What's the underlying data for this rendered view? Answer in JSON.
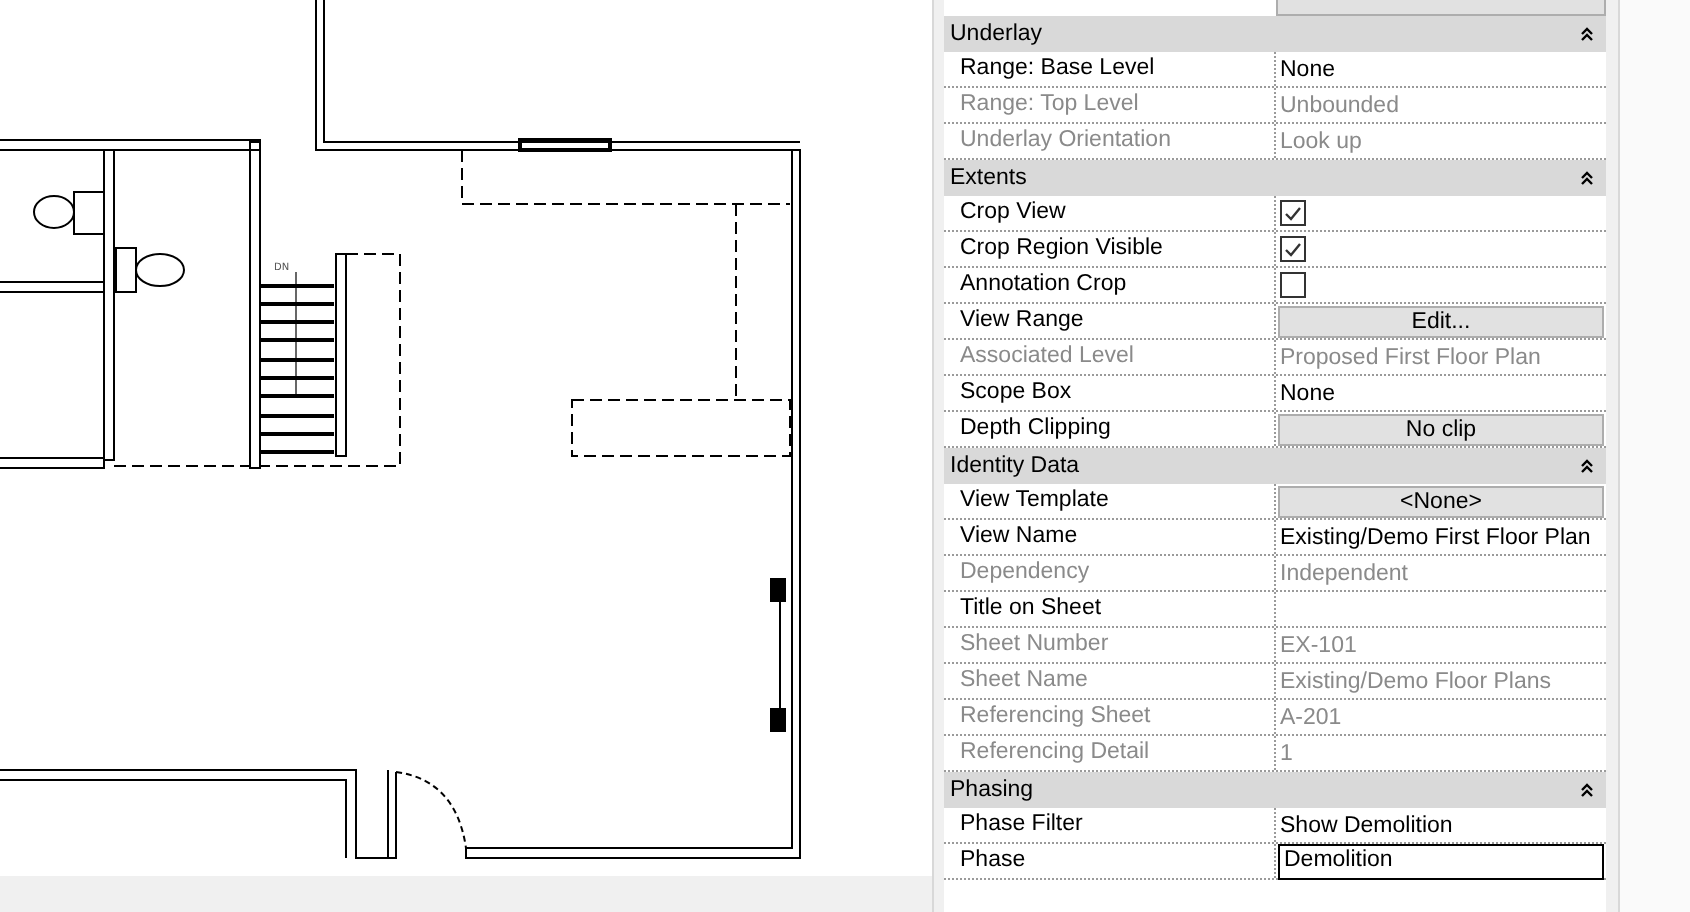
{
  "floor_plan": {
    "stair_label": "DN"
  },
  "properties": {
    "sections": [
      {
        "title": "Underlay",
        "expanded": true,
        "rows": [
          {
            "label": "Range: Base Level",
            "kind": "text",
            "value": "None",
            "disabled": false
          },
          {
            "label": "Range: Top Level",
            "kind": "text",
            "value": "Unbounded",
            "disabled": true
          },
          {
            "label": "Underlay Orientation",
            "kind": "text",
            "value": "Look up",
            "disabled": true
          }
        ]
      },
      {
        "title": "Extents",
        "expanded": true,
        "rows": [
          {
            "label": "Crop View",
            "kind": "checkbox",
            "checked": true,
            "disabled": false
          },
          {
            "label": "Crop Region Visible",
            "kind": "checkbox",
            "checked": true,
            "disabled": false
          },
          {
            "label": "Annotation Crop",
            "kind": "checkbox",
            "checked": false,
            "disabled": false
          },
          {
            "label": "View Range",
            "kind": "button",
            "value": "Edit...",
            "disabled": false
          },
          {
            "label": "Associated Level",
            "kind": "text",
            "value": "Proposed First Floor Plan",
            "disabled": true
          },
          {
            "label": "Scope Box",
            "kind": "text",
            "value": "None",
            "disabled": false
          },
          {
            "label": "Depth Clipping",
            "kind": "button",
            "value": "No clip",
            "disabled": false
          }
        ]
      },
      {
        "title": "Identity Data",
        "expanded": true,
        "rows": [
          {
            "label": "View Template",
            "kind": "button",
            "value": "<None>",
            "disabled": false
          },
          {
            "label": "View Name",
            "kind": "text",
            "value": "Existing/Demo First Floor Plan",
            "disabled": false
          },
          {
            "label": "Dependency",
            "kind": "text",
            "value": "Independent",
            "disabled": true
          },
          {
            "label": "Title on Sheet",
            "kind": "text",
            "value": "",
            "disabled": false
          },
          {
            "label": "Sheet Number",
            "kind": "text",
            "value": "EX-101",
            "disabled": true
          },
          {
            "label": "Sheet Name",
            "kind": "text",
            "value": "Existing/Demo Floor Plans",
            "disabled": true
          },
          {
            "label": "Referencing Sheet",
            "kind": "text",
            "value": "A-201",
            "disabled": true
          },
          {
            "label": "Referencing Detail",
            "kind": "text",
            "value": "1",
            "disabled": true
          }
        ]
      },
      {
        "title": "Phasing",
        "expanded": true,
        "rows": [
          {
            "label": "Phase Filter",
            "kind": "text",
            "value": "Show Demolition",
            "disabled": false
          },
          {
            "label": "Phase",
            "kind": "field",
            "value": "Demolition",
            "disabled": false
          }
        ]
      }
    ]
  }
}
